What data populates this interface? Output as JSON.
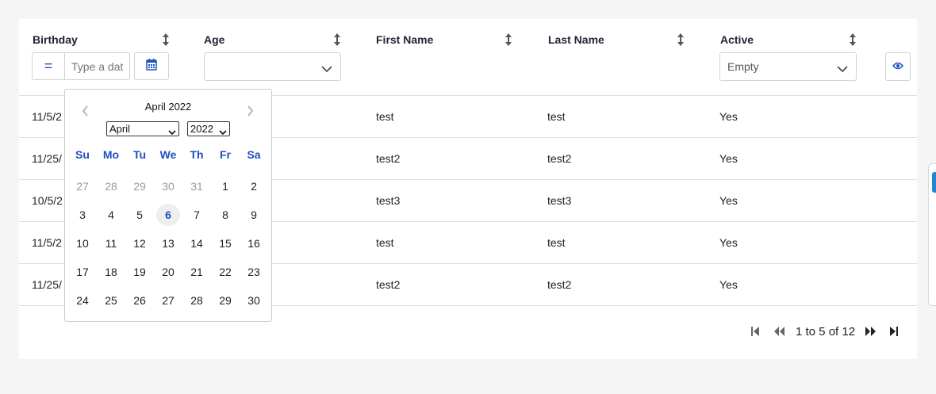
{
  "columns": [
    {
      "key": "birthday",
      "label": "Birthday"
    },
    {
      "key": "age",
      "label": "Age"
    },
    {
      "key": "first_name",
      "label": "First Name"
    },
    {
      "key": "last_name",
      "label": "Last Name"
    },
    {
      "key": "active",
      "label": "Active"
    }
  ],
  "filters": {
    "birthday_operator": "=",
    "birthday_placeholder": "Type a date",
    "age_value": "",
    "active_value": "Empty"
  },
  "rows": [
    {
      "birthday": "11/5/2",
      "first_name": "test",
      "last_name": "test",
      "active": "Yes"
    },
    {
      "birthday": "11/25/",
      "first_name": "test2",
      "last_name": "test2",
      "active": "Yes"
    },
    {
      "birthday": "10/5/2",
      "first_name": "test3",
      "last_name": "test3",
      "active": "Yes"
    },
    {
      "birthday": "11/5/2",
      "first_name": "test",
      "last_name": "test",
      "active": "Yes"
    },
    {
      "birthday": "11/25/",
      "first_name": "test2",
      "last_name": "test2",
      "active": "Yes"
    }
  ],
  "datepicker": {
    "title": "April 2022",
    "month_select": "April",
    "year_select": "2022",
    "weekdays": [
      "Su",
      "Mo",
      "Tu",
      "We",
      "Th",
      "Fr",
      "Sa"
    ],
    "weeks": [
      [
        "27",
        "28",
        "29",
        "30",
        "31",
        "1",
        "2"
      ],
      [
        "3",
        "4",
        "5",
        "6",
        "7",
        "8",
        "9"
      ],
      [
        "10",
        "11",
        "12",
        "13",
        "14",
        "15",
        "16"
      ],
      [
        "17",
        "18",
        "19",
        "20",
        "21",
        "22",
        "23"
      ],
      [
        "24",
        "25",
        "26",
        "27",
        "28",
        "29",
        "30"
      ]
    ],
    "outside_month_first_row": 5,
    "today": "6"
  },
  "pagination": {
    "summary": "1 to 5 of 12"
  },
  "colors": {
    "accent": "#1f4ec0",
    "border": "#cfd3da",
    "muted_day": "#9a9a9a"
  }
}
